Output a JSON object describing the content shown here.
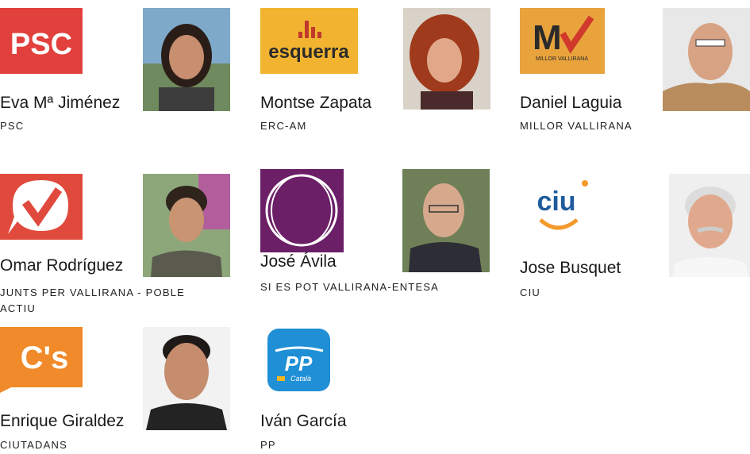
{
  "colors": {
    "psc_red": "#e2403c",
    "erc_yellow": "#f2b430",
    "millor_orange": "#e8a33d",
    "junts_red": "#e04a3c",
    "podem_purple": "#6b1f67",
    "ciu_orange": "#f39a2b",
    "ciu_blue": "#1f5c9c",
    "cs_orange": "#f08a2a",
    "pp_blue": "#1f8fd6"
  },
  "candidates": [
    {
      "name": "Eva Mª Jiménez",
      "party": "PSC",
      "logo_text": "PSC",
      "logo_icon": "psc-logo",
      "photo_icon": "person-photo"
    },
    {
      "name": "Montse Zapata",
      "party": "ERC-AM",
      "logo_text": "esquerra",
      "logo_icon": "erc-logo",
      "photo_icon": "person-photo"
    },
    {
      "name": "Daniel Laguia",
      "party": "MILLOR VALLIRANA",
      "logo_text": "M",
      "logo_subtext": "MILLOR VALLIRANA",
      "logo_icon": "millor-vallirana-logo",
      "photo_icon": "person-photo"
    },
    {
      "name": "Omar Rodríguez",
      "party_line1": "JUNTS PER VALLIRANA - POBLE",
      "party_line2": "ACTIU",
      "logo_icon": "junts-checkmark-logo",
      "photo_icon": "person-photo"
    },
    {
      "name": "José Ávila",
      "party": "SI ES POT VALLIRANA-ENTESA",
      "logo_icon": "podem-circles-logo",
      "photo_icon": "person-photo"
    },
    {
      "name": "Jose Busquet",
      "party": "CIU",
      "logo_text": "ciu",
      "logo_icon": "ciu-smile-logo",
      "photo_icon": "person-photo"
    },
    {
      "name": "Enrique Giraldez",
      "party": "CIUTADANS",
      "logo_text": "C's",
      "logo_icon": "ciutadans-logo",
      "photo_icon": "person-photo"
    },
    {
      "name": "Iván García",
      "party": "PP",
      "logo_text": "PP",
      "logo_subtext": "Català",
      "logo_icon": "pp-logo"
    }
  ]
}
